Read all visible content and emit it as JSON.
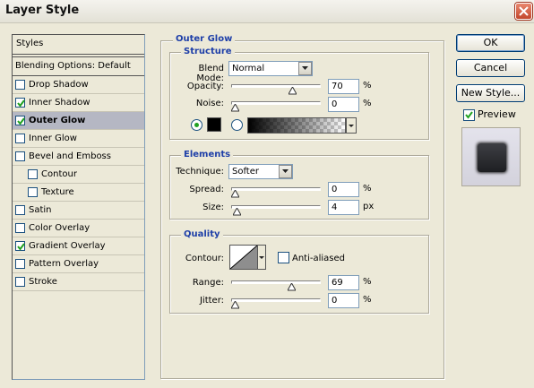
{
  "window": {
    "title": "Layer Style"
  },
  "styles_panel": {
    "header": "Styles",
    "blending_options": "Blending Options: Default",
    "items": [
      {
        "label": "Drop Shadow",
        "checked": false,
        "indent": false,
        "selected": false
      },
      {
        "label": "Inner Shadow",
        "checked": true,
        "indent": false,
        "selected": false
      },
      {
        "label": "Outer Glow",
        "checked": true,
        "indent": false,
        "selected": true
      },
      {
        "label": "Inner Glow",
        "checked": false,
        "indent": false,
        "selected": false
      },
      {
        "label": "Bevel and Emboss",
        "checked": false,
        "indent": false,
        "selected": false
      },
      {
        "label": "Contour",
        "checked": false,
        "indent": true,
        "selected": false
      },
      {
        "label": "Texture",
        "checked": false,
        "indent": true,
        "selected": false
      },
      {
        "label": "Satin",
        "checked": false,
        "indent": false,
        "selected": false
      },
      {
        "label": "Color Overlay",
        "checked": false,
        "indent": false,
        "selected": false
      },
      {
        "label": "Gradient Overlay",
        "checked": true,
        "indent": false,
        "selected": false
      },
      {
        "label": "Pattern Overlay",
        "checked": false,
        "indent": false,
        "selected": false
      },
      {
        "label": "Stroke",
        "checked": false,
        "indent": false,
        "selected": false
      }
    ]
  },
  "outer_glow": {
    "title": "Outer Glow",
    "structure": {
      "legend": "Structure",
      "blend_mode_label": "Blend Mode:",
      "blend_mode_value": "Normal",
      "opacity_label": "Opacity:",
      "opacity_value": "70",
      "opacity_unit": "%",
      "opacity_level": 0.7,
      "noise_label": "Noise:",
      "noise_value": "0",
      "noise_unit": "%",
      "noise_level": 0,
      "glow_color": "#000000",
      "color_mode": "solid"
    },
    "elements": {
      "legend": "Elements",
      "technique_label": "Technique:",
      "technique_value": "Softer",
      "spread_label": "Spread:",
      "spread_value": "0",
      "spread_unit": "%",
      "spread_level": 0,
      "size_label": "Size:",
      "size_value": "4",
      "size_unit": "px",
      "size_level": 0.02
    },
    "quality": {
      "legend": "Quality",
      "contour_label": "Contour:",
      "anti_aliased_label": "Anti-aliased",
      "anti_aliased_checked": false,
      "range_label": "Range:",
      "range_value": "69",
      "range_unit": "%",
      "range_level": 0.69,
      "jitter_label": "Jitter:",
      "jitter_value": "0",
      "jitter_unit": "%",
      "jitter_level": 0
    }
  },
  "buttons": {
    "ok": "OK",
    "cancel": "Cancel",
    "new_style": "New Style...",
    "preview_label": "Preview",
    "preview_checked": true
  }
}
